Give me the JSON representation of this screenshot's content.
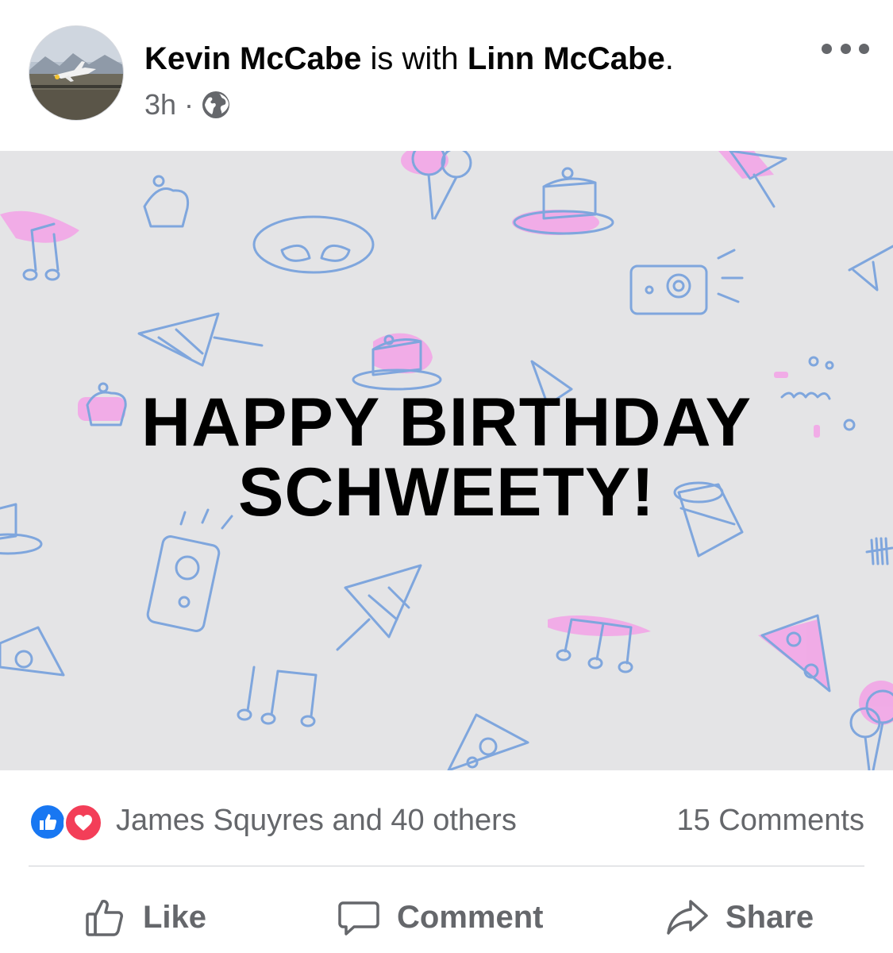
{
  "post": {
    "author": "Kevin McCabe",
    "with_text": "is with",
    "tagged": "Linn McCabe",
    "period": ".",
    "time": "3h",
    "separator": "·",
    "privacy_icon": "globe-icon",
    "more_icon": "more-options-icon"
  },
  "banner": {
    "line1": "HAPPY BIRTHDAY",
    "line2": "SCHWEETY!",
    "background": "#e4e4e6",
    "doodle_color": "#7fa6dd",
    "accent_color": "#f3a2e6"
  },
  "reactions": {
    "icons": [
      "like-icon",
      "love-icon"
    ],
    "summary": "James Squyres and 40 others",
    "comments": "15 Comments"
  },
  "actions": {
    "like": "Like",
    "comment": "Comment",
    "share": "Share"
  },
  "colors": {
    "like_blue": "#1877f2",
    "love_red": "#f33e58",
    "secondary_text": "#65676b"
  }
}
